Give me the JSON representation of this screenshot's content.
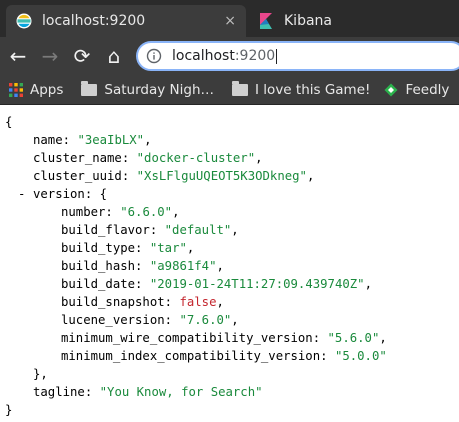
{
  "tabs": [
    {
      "title": "localhost:9200",
      "active": true,
      "icon": "elasticsearch-icon",
      "close": "×"
    },
    {
      "title": "Kibana",
      "active": false,
      "icon": "kibana-icon"
    }
  ],
  "toolbar": {
    "back": "←",
    "forward": "→",
    "reload": "⟳",
    "home": "⌂",
    "url_host": "localhost",
    "url_port": ":9200"
  },
  "bookmarks": [
    {
      "label": "Apps",
      "icon": "apps-grid-icon"
    },
    {
      "label": "Saturday Nigh…",
      "icon": "folder-icon"
    },
    {
      "label": "I love this Game!",
      "icon": "folder-icon"
    },
    {
      "label": "Feedly",
      "icon": "feedly-icon"
    }
  ],
  "json": {
    "open_brace": "{",
    "close_brace": "}",
    "name_key": "name",
    "name_val": "\"3eaIbLX\"",
    "cluster_name_key": "cluster_name",
    "cluster_name_val": "\"docker-cluster\"",
    "cluster_uuid_key": "cluster_uuid",
    "cluster_uuid_val": "\"XsLFlguUQEOT5K3ODkneg\"",
    "version_toggle": "-",
    "version_key": "version",
    "version_open": ": {",
    "version_close": "},",
    "tagline_key": "tagline",
    "tagline_val": "\"You Know, for Search\"",
    "version": [
      {
        "key": "number",
        "val": "\"6.6.0\"",
        "type": "string"
      },
      {
        "key": "build_flavor",
        "val": "\"default\"",
        "type": "string"
      },
      {
        "key": "build_type",
        "val": "\"tar\"",
        "type": "string"
      },
      {
        "key": "build_hash",
        "val": "\"a9861f4\"",
        "type": "string"
      },
      {
        "key": "build_date",
        "val": "\"2019-01-24T11:27:09.439740Z\"",
        "type": "string"
      },
      {
        "key": "build_snapshot",
        "val": "false",
        "type": "bool"
      },
      {
        "key": "lucene_version",
        "val": "\"7.6.0\"",
        "type": "string"
      },
      {
        "key": "minimum_wire_compatibility_version",
        "val": "\"5.6.0\"",
        "type": "string"
      },
      {
        "key": "minimum_index_compatibility_version",
        "val": "\"5.0.0\"",
        "type": "string"
      }
    ]
  },
  "colors": {
    "string": "#1a8a3c",
    "bool": "#c4262e",
    "chrome_dark": "#2b2b2b",
    "chrome_mid": "#3c3c3c"
  }
}
